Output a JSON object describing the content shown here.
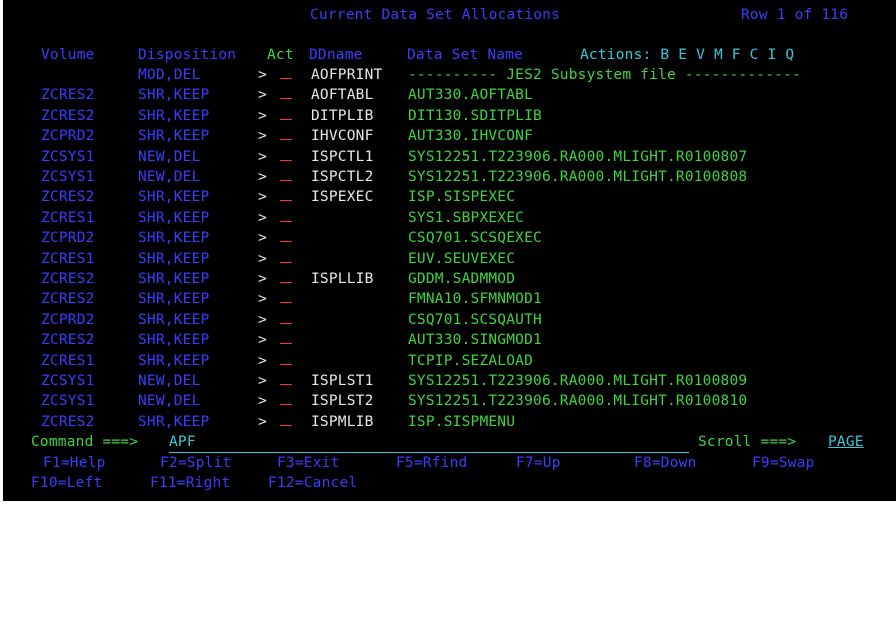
{
  "title": "Current Data Set Allocations",
  "row_indicator": "Row 1 of 116",
  "headers": {
    "volume": "Volume",
    "disposition": "Disposition",
    "act": "Act",
    "ddname": "DDname",
    "dsname": "Data Set Name",
    "actions": "Actions: B E V M F C I Q"
  },
  "rows": [
    {
      "volume": "",
      "disposition": "MOD,DEL",
      "ddname": "AOFPRINT",
      "dsname": "---------- JES2 Subsystem file -------------"
    },
    {
      "volume": "ZCRES2",
      "disposition": "SHR,KEEP",
      "ddname": "AOFTABL",
      "dsname": "AUT330.AOFTABL"
    },
    {
      "volume": "ZCRES2",
      "disposition": "SHR,KEEP",
      "ddname": "DITPLIB",
      "dsname": "DIT130.SDITPLIB"
    },
    {
      "volume": "ZCPRD2",
      "disposition": "SHR,KEEP",
      "ddname": "IHVCONF",
      "dsname": "AUT330.IHVCONF"
    },
    {
      "volume": "ZCSYS1",
      "disposition": "NEW,DEL",
      "ddname": "ISPCTL1",
      "dsname": "SYS12251.T223906.RA000.MLIGHT.R0100807"
    },
    {
      "volume": "ZCSYS1",
      "disposition": "NEW,DEL",
      "ddname": "ISPCTL2",
      "dsname": "SYS12251.T223906.RA000.MLIGHT.R0100808"
    },
    {
      "volume": "ZCRES2",
      "disposition": "SHR,KEEP",
      "ddname": "ISPEXEC",
      "dsname": "ISP.SISPEXEC"
    },
    {
      "volume": "ZCRES1",
      "disposition": "SHR,KEEP",
      "ddname": "",
      "dsname": "SYS1.SBPXEXEC"
    },
    {
      "volume": "ZCPRD2",
      "disposition": "SHR,KEEP",
      "ddname": "",
      "dsname": "CSQ701.SCSQEXEC"
    },
    {
      "volume": "ZCRES1",
      "disposition": "SHR,KEEP",
      "ddname": "",
      "dsname": "EUV.SEUVEXEC"
    },
    {
      "volume": "ZCRES2",
      "disposition": "SHR,KEEP",
      "ddname": "ISPLLIB",
      "dsname": "GDDM.SADMMOD"
    },
    {
      "volume": "ZCRES2",
      "disposition": "SHR,KEEP",
      "ddname": "",
      "dsname": "FMNA10.SFMNMOD1"
    },
    {
      "volume": "ZCPRD2",
      "disposition": "SHR,KEEP",
      "ddname": "",
      "dsname": "CSQ701.SCSQAUTH"
    },
    {
      "volume": "ZCRES2",
      "disposition": "SHR,KEEP",
      "ddname": "",
      "dsname": "AUT330.SINGMOD1"
    },
    {
      "volume": "ZCRES1",
      "disposition": "SHR,KEEP",
      "ddname": "",
      "dsname": "TCPIP.SEZALOAD"
    },
    {
      "volume": "ZCSYS1",
      "disposition": "NEW,DEL",
      "ddname": "ISPLST1",
      "dsname": "SYS12251.T223906.RA000.MLIGHT.R0100809"
    },
    {
      "volume": "ZCSYS1",
      "disposition": "NEW,DEL",
      "ddname": "ISPLST2",
      "dsname": "SYS12251.T223906.RA000.MLIGHT.R0100810"
    },
    {
      "volume": "ZCRES2",
      "disposition": "SHR,KEEP",
      "ddname": "ISPMLIB",
      "dsname": "ISP.SISPMENU"
    }
  ],
  "act_arrow": ">",
  "command": {
    "label": "Command ===>",
    "value": "APF"
  },
  "scroll": {
    "label": "Scroll ===>",
    "value": "PAGE"
  },
  "pfkeys": [
    {
      "label": "F1=Help"
    },
    {
      "label": "F2=Split"
    },
    {
      "label": "F3=Exit"
    },
    {
      "label": "F5=Rfind"
    },
    {
      "label": "F7=Up"
    },
    {
      "label": "F8=Down"
    },
    {
      "label": "F9=Swap"
    },
    {
      "label": "F10=Left"
    },
    {
      "label": "F11=Right"
    },
    {
      "label": "F12=Cancel"
    }
  ],
  "colors": {
    "background": "#000000",
    "field_label": "#3c3cff",
    "header_cyan": "#36c8d8",
    "data_green": "#3ed43e",
    "ddname_white": "#e8e8e8",
    "input_red": "#ff3030",
    "act_yellow": "#f0f000"
  }
}
